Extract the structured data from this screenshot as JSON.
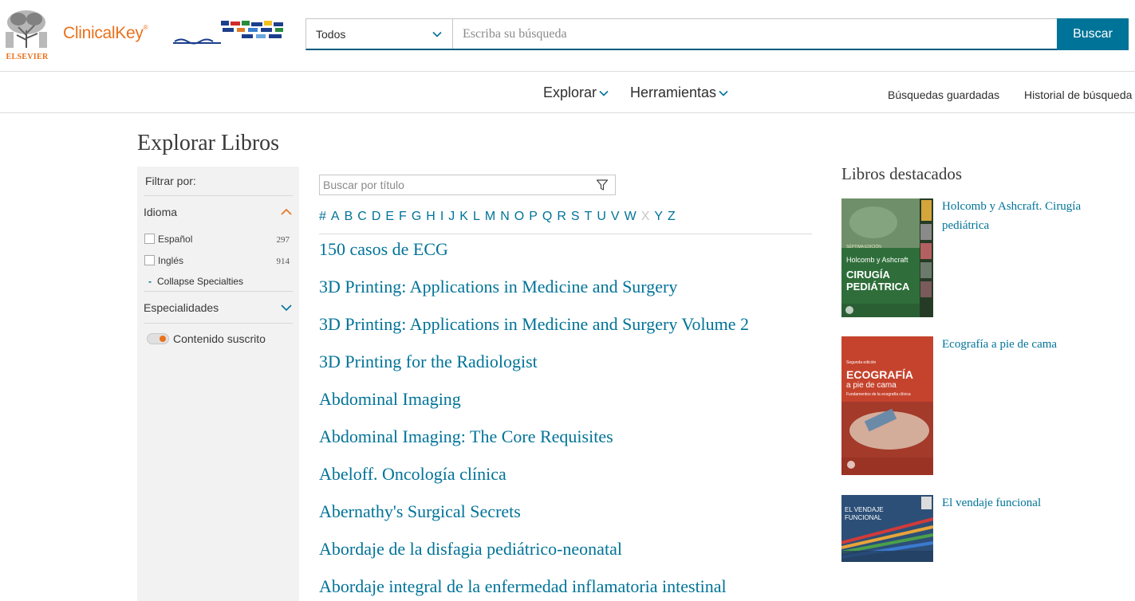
{
  "header": {
    "elsevier_label": "ELSEVIER",
    "clinicalkey_label": "ClinicalKey",
    "clinicalkey_mark": "®",
    "search_scope": "Todos",
    "search_placeholder": "Escriba su búsqueda",
    "search_button": "Buscar"
  },
  "nav": {
    "explore": "Explorar",
    "tools": "Herramientas",
    "saved_searches": "Búsquedas guardadas",
    "search_history": "Historial de búsqueda"
  },
  "page": {
    "title": "Explorar Libros"
  },
  "sidebar": {
    "filter_by": "Filtrar por:",
    "language": {
      "label": "Idioma",
      "options": [
        {
          "label": "Español",
          "count": "297"
        },
        {
          "label": "Inglés",
          "count": "914"
        }
      ],
      "collapse_label": "Collapse Specialties"
    },
    "specialties": {
      "label": "Especialidades"
    },
    "subscribed": {
      "label": "Contenido suscrito"
    }
  },
  "title_search": {
    "placeholder": "Buscar por título"
  },
  "alphabet": [
    "#",
    "A",
    "B",
    "C",
    "D",
    "E",
    "F",
    "G",
    "H",
    "I",
    "J",
    "K",
    "L",
    "M",
    "N",
    "O",
    "P",
    "Q",
    "R",
    "S",
    "T",
    "U",
    "V",
    "W",
    "X",
    "Y",
    "Z"
  ],
  "alphabet_disabled": [
    "X"
  ],
  "books": [
    "150 casos de ECG",
    "3D Printing: Applications in Medicine and Surgery",
    "3D Printing: Applications in Medicine and Surgery Volume 2",
    "3D Printing for the Radiologist",
    "Abdominal Imaging",
    "Abdominal Imaging: The Core Requisites",
    "Abeloff. Oncología clínica",
    "Abernathy's Surgical Secrets",
    "Abordaje de la disfagia pediátrico-neonatal",
    "Abordaje integral de la enfermedad inflamatoria intestinal"
  ],
  "featured": {
    "title": "Libros destacados",
    "books": [
      {
        "title": "Holcomb y Ashcraft. Cirugía pediátrica",
        "cover_edition": "SÉPTIMA EDICIÓN",
        "cover_authors": "Holcomb y Ashcraft",
        "cover_title": "CIRUGÍA PEDIÁTRICA",
        "cover_color": "#2f6e3a"
      },
      {
        "title": "Ecografía a pie de cama",
        "cover_edition": "Segunda edición",
        "cover_title": "ECOGRAFÍA",
        "cover_subtitle": "a pie de cama",
        "cover_tagline": "Fundamentos de la ecografía clínica",
        "cover_color": "#c5432d"
      },
      {
        "title": "El vendaje funcional",
        "cover_title": "EL VENDAJE FUNCIONAL",
        "cover_color": "#2c4f77"
      }
    ]
  },
  "colors": {
    "brand_orange": "#e9711c",
    "link_blue": "#007398",
    "search_underline": "#005b7e"
  }
}
